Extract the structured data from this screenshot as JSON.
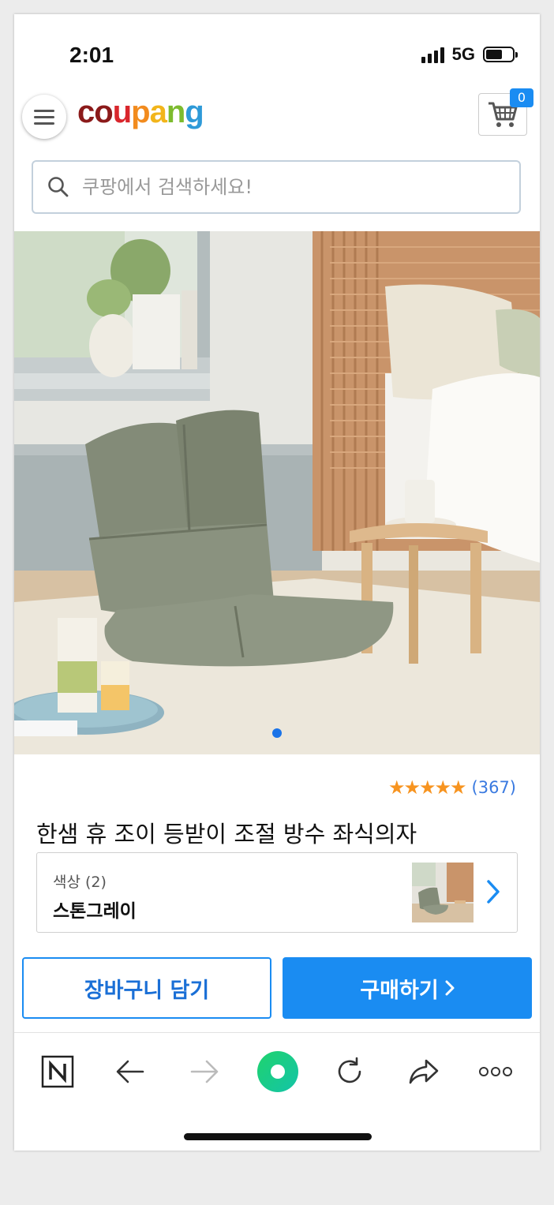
{
  "status_bar": {
    "time": "2:01",
    "network": "5G"
  },
  "header": {
    "logo_letters": [
      {
        "ch": "c",
        "color": "#8b1a1a"
      },
      {
        "ch": "o",
        "color": "#8b1a1a"
      },
      {
        "ch": "u",
        "color": "#d9262c"
      },
      {
        "ch": "p",
        "color": "#f28b1e"
      },
      {
        "ch": "a",
        "color": "#f2b51b"
      },
      {
        "ch": "n",
        "color": "#7dbb2e"
      },
      {
        "ch": "g",
        "color": "#2e9ad8"
      }
    ],
    "cart_count": "0",
    "search_placeholder": "쿠팡에서 검색하세요!"
  },
  "product": {
    "rating_stars": "★★★★★",
    "review_count": "(367)",
    "title": "한샘 휴 조이 등받이 조절 방수 좌식의자",
    "option": {
      "label": "색상 (2)",
      "value": "스톤그레이"
    }
  },
  "actions": {
    "add_to_cart": "장바구니 담기",
    "buy_now": "구매하기"
  },
  "colors": {
    "accent": "#1a8cf2",
    "star": "#f79420",
    "link": "#3a7ae0"
  },
  "toolbar_icons": [
    "naver-icon",
    "back-arrow-icon",
    "forward-arrow-icon",
    "green-dot-icon",
    "reload-icon",
    "share-icon",
    "more-icon"
  ]
}
